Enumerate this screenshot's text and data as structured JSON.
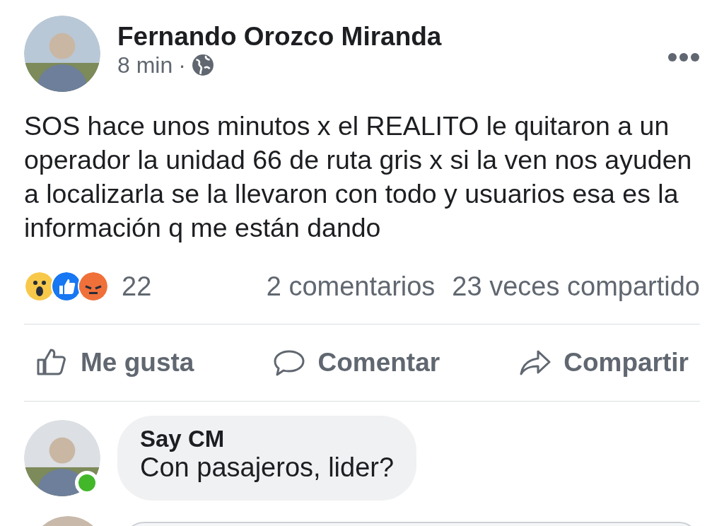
{
  "post": {
    "author": "Fernando Orozco Miranda",
    "time": "8 min",
    "separator": "·",
    "text": "SOS hace unos minutos x el REALITO le quitaron a un operador la unidad 66 de ruta gris x si la ven nos ayuden a localizarla se la llevaron con todo y usuarios esa es la información q me están dando",
    "reactions": [
      {
        "kind": "wow"
      },
      {
        "kind": "like"
      },
      {
        "kind": "angry"
      }
    ],
    "reaction_count": "22",
    "comments_count": "2 comentarios",
    "shares_count": "23 veces compartido",
    "actions": [
      {
        "kind": "like",
        "label": "Me gusta"
      },
      {
        "kind": "comment",
        "label": "Comentar"
      },
      {
        "kind": "share",
        "label": "Compartir"
      }
    ]
  },
  "comments": [
    {
      "author": "Say CM",
      "text": "Con pasajeros, lider?",
      "online": true
    }
  ],
  "composer": {
    "kind": "field"
  }
}
